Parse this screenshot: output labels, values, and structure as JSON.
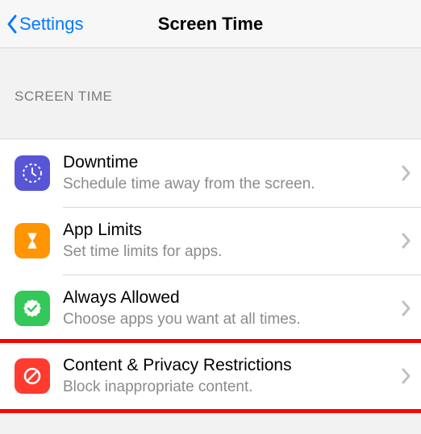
{
  "nav": {
    "back_label": "Settings",
    "title": "Screen Time"
  },
  "section_header": "SCREEN TIME",
  "items": [
    {
      "icon": "clock-icon",
      "icon_bg": "ic-purple",
      "title": "Downtime",
      "subtitle": "Schedule time away from the screen."
    },
    {
      "icon": "hourglass-icon",
      "icon_bg": "ic-orange",
      "title": "App Limits",
      "subtitle": "Set time limits for apps."
    },
    {
      "icon": "check-seal-icon",
      "icon_bg": "ic-green",
      "title": "Always Allowed",
      "subtitle": "Choose apps you want at all times."
    },
    {
      "icon": "no-entry-icon",
      "icon_bg": "ic-red",
      "title": "Content & Privacy Restrictions",
      "subtitle": "Block inappropriate content."
    }
  ],
  "highlight_index": 3
}
